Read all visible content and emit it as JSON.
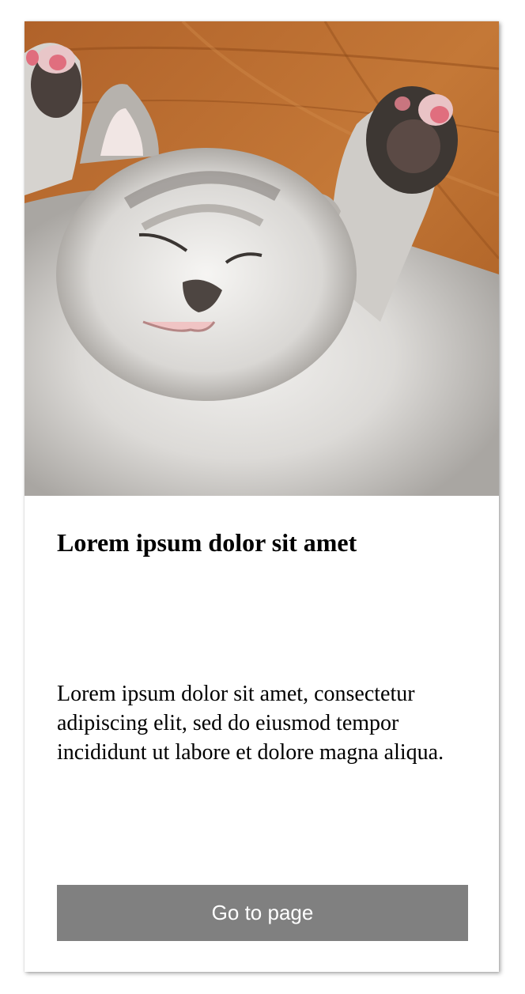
{
  "card": {
    "image_subject": "sleeping-kitten-photo",
    "title": "Lorem ipsum dolor sit amet",
    "description": "Lorem ipsum dolor sit amet, consectetur adipiscing elit, sed do eiusmod tempor incididunt ut labore et dolore magna aliqua.",
    "button_label": "Go to page"
  },
  "colors": {
    "button_background": "#808080",
    "button_text": "#ffffff",
    "card_background": "#ffffff",
    "text": "#000000"
  }
}
